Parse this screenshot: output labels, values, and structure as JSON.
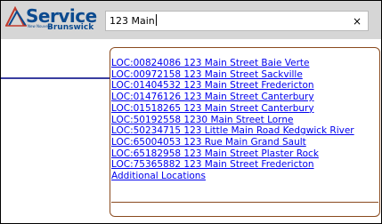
{
  "logo": {
    "name": "Service",
    "province": "Brunswick",
    "small_text": "New Nouveau"
  },
  "search": {
    "value": "123 Main",
    "clear_label": "×"
  },
  "results": [
    "LOC:00824086 123 Main Street Baie Verte",
    "LOC:00972158 123 Main Street Sackville",
    "LOC:01404532 123 Main Street Fredericton",
    "LOC:01476126 123 Main Street Canterbury",
    "LOC:01518265 123 Main Street Canterbury",
    "LOC:50192558 1230 Main Street Lorne",
    "LOC:50234715 123 Little Main Road Kedgwick River",
    "LOC:65004053 123 Rue Main Grand Sault",
    "LOC:65182958 123 Main Street Plaster Rock",
    "LOC:75365882 123 Main Street Fredericton",
    "Additional Locations"
  ],
  "colors": {
    "header_bg": "#d6d6d6",
    "brand_blue": "#0b4a8f",
    "link": "#0000ee",
    "dropdown_border": "#8a4a1e",
    "accent_line": "#3a3da0"
  }
}
